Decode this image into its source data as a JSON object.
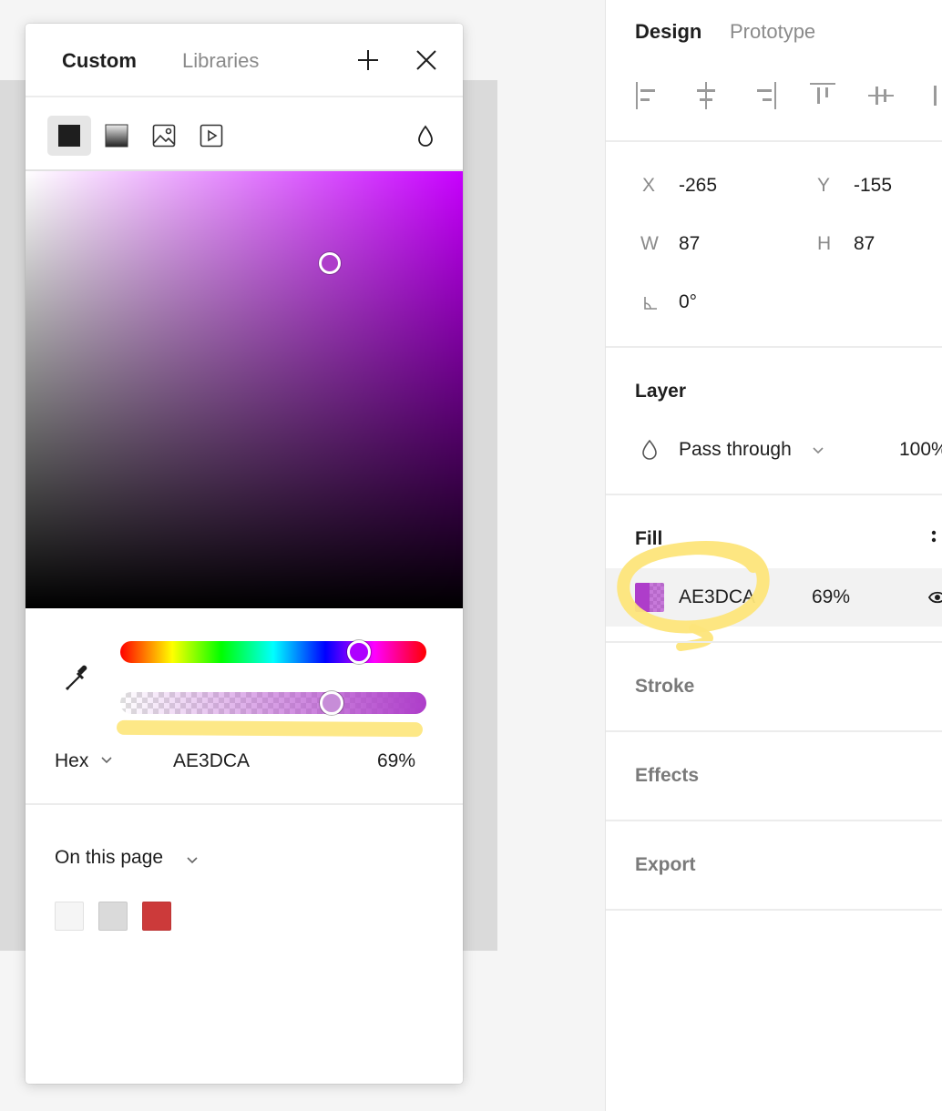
{
  "picker": {
    "tabs": {
      "custom": "Custom",
      "libraries": "Libraries"
    },
    "paint_types": [
      "solid",
      "gradient",
      "image",
      "video"
    ],
    "color": {
      "hex": "AE3DCA",
      "opacity": "69%",
      "format": "Hex",
      "hue_position": 0.78,
      "alpha_position": 0.69
    },
    "page_colors": {
      "label": "On this page",
      "swatches": [
        "#f5f5f5",
        "#dadada",
        "#cc3a3a"
      ]
    }
  },
  "panel": {
    "tabs": {
      "design": "Design",
      "prototype": "Prototype"
    },
    "position": {
      "x_label": "X",
      "x": "-265",
      "y_label": "Y",
      "y": "-155",
      "w_label": "W",
      "w": "87",
      "h_label": "H",
      "h": "87",
      "rotation": "0°"
    },
    "layer": {
      "title": "Layer",
      "blend": "Pass through",
      "opacity": "100%"
    },
    "fill": {
      "title": "Fill",
      "hex": "AE3DCA",
      "opacity": "69%",
      "color": "#ae3dca"
    },
    "stroke": {
      "title": "Stroke"
    },
    "effects": {
      "title": "Effects"
    },
    "export": {
      "title": "Export"
    }
  },
  "colors": {
    "accent": "#ae3dca",
    "highlight": "#fde57a"
  }
}
